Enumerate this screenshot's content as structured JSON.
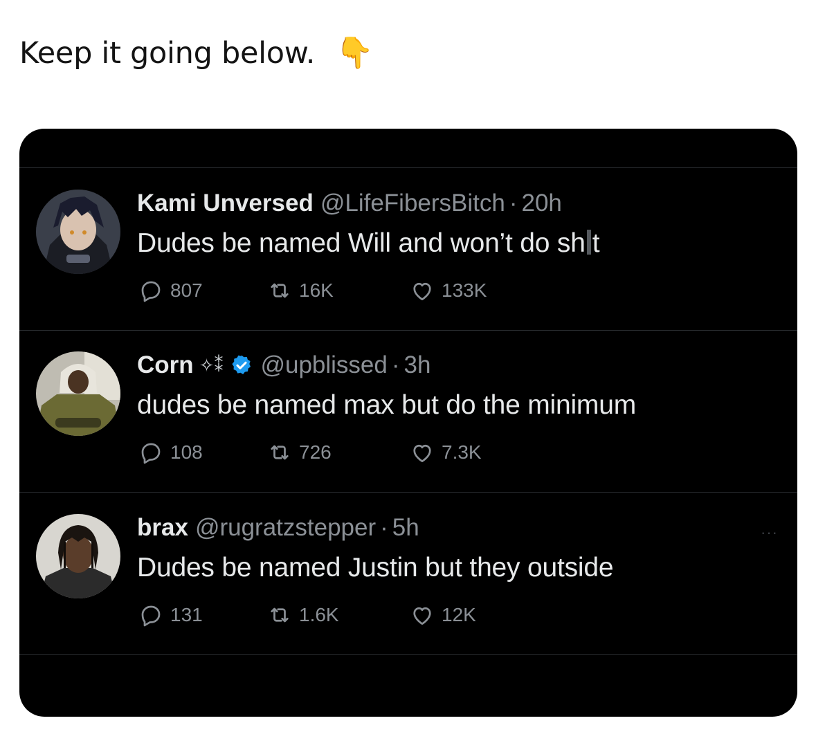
{
  "caption": {
    "text": "Keep it going below.",
    "emoji": "👇"
  },
  "colors": {
    "card_bg": "#000000",
    "primary_text": "#e7e9ea",
    "secondary_text": "#8b9096",
    "verified_blue": "#1d9bf0"
  },
  "tweets": [
    {
      "name": "Kami Unversed",
      "handle": "@LifeFibersBitch",
      "dot": "·",
      "time": "20h",
      "text_before": "Dudes be named Will and won’t do sh",
      "text_after": "t",
      "replies": "807",
      "retweets": "16K",
      "likes": "133K"
    },
    {
      "name": "Corn",
      "name_decoration": "✧⁑",
      "verified": true,
      "handle": "@upblissed",
      "dot": "·",
      "time": "3h",
      "text": "dudes be named max but do the minimum",
      "replies": "108",
      "retweets": "726",
      "likes": "7.3K"
    },
    {
      "name": "brax",
      "handle": "@rugratzstepper",
      "dot": "·",
      "time": "5h",
      "text": "Dudes be named Justin but they outside",
      "replies": "131",
      "retweets": "1.6K",
      "likes": "12K",
      "more": "···"
    }
  ]
}
